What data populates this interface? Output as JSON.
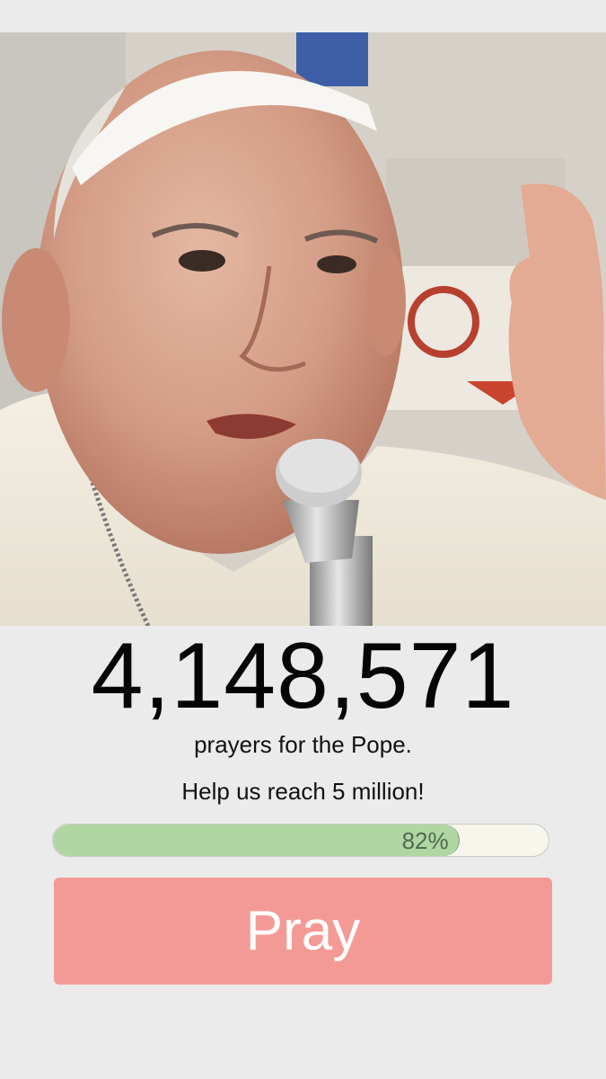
{
  "hero": {
    "image_subject": "Pope Francis speaking into a microphone"
  },
  "counter": {
    "value": "4,148,571",
    "caption": "prayers for the Pope."
  },
  "goal": {
    "text": "Help us reach 5 million!"
  },
  "progress": {
    "percent": 82,
    "label": "82%",
    "fill_color": "#b0d6a4",
    "track_color": "#f6f6ec"
  },
  "actions": {
    "pray_label": "Pray",
    "pray_color": "#f49a96"
  }
}
